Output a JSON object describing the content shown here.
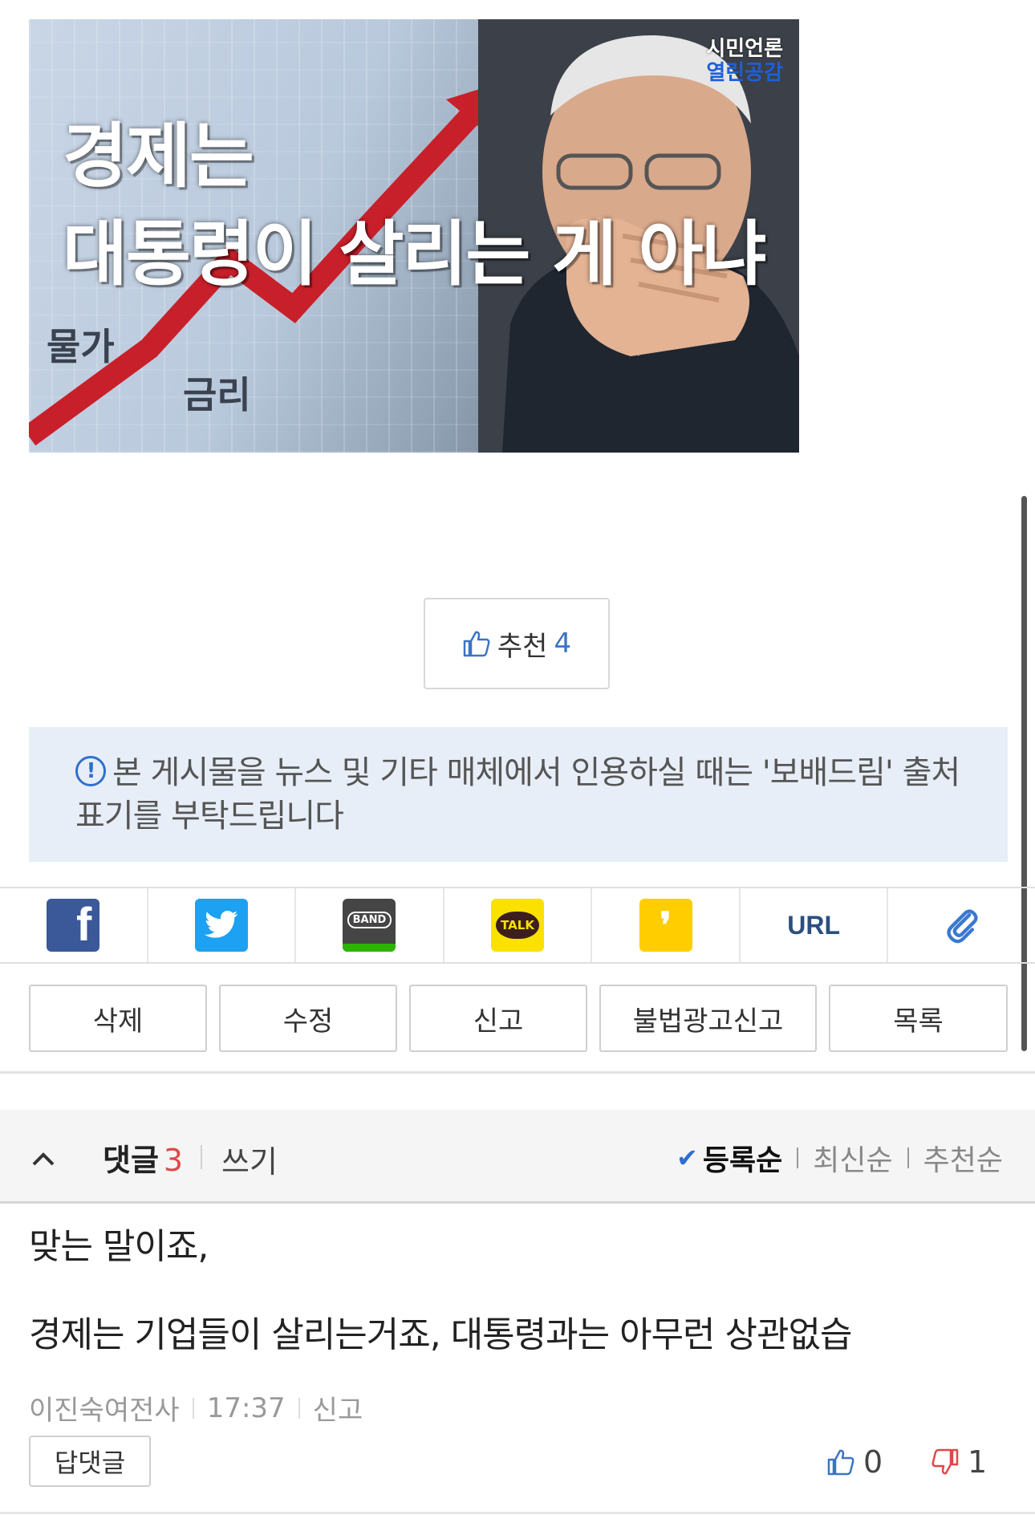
{
  "hero": {
    "headline_line1": "경제는",
    "headline_line2": "대통령이 살리는 게 아냐",
    "label_prices": "물가",
    "label_rates": "금리",
    "brand_line1": "시민언론",
    "brand_line2": "열린공감"
  },
  "recommend": {
    "label": "추천",
    "count": "4",
    "icon": "thumbs-up-icon"
  },
  "notice": {
    "icon": "info-circle-icon",
    "text": "본 게시물을 뉴스 및 기타 매체에서 인용하실 때는 '보배드림' 출처 표기를 부탁드립니다"
  },
  "share": {
    "items": [
      {
        "name": "facebook",
        "glyph": "f",
        "color": "#3b5998"
      },
      {
        "name": "twitter",
        "color": "#1da1f2"
      },
      {
        "name": "band",
        "glyph": "BAND",
        "color": "#454545"
      },
      {
        "name": "kakaotalk",
        "glyph": "TALK",
        "color": "#fae100"
      },
      {
        "name": "kakaostory",
        "glyph": "❜",
        "color": "#ffcd00"
      },
      {
        "name": "url",
        "glyph": "URL"
      },
      {
        "name": "clip",
        "glyph": "📎"
      }
    ]
  },
  "actions": {
    "delete": "삭제",
    "edit": "수정",
    "report": "신고",
    "illegal_ad_report": "불법광고신고",
    "list": "목록"
  },
  "comments": {
    "title": "댓글",
    "count": "3",
    "write": "쓰기",
    "sort_registered": "등록순",
    "sort_latest": "최신순",
    "sort_recommended": "추천순",
    "active_sort": "등록순",
    "items": [
      {
        "line1": "맞는 말이죠,",
        "line2": "경제는 기업들이 살리는거죠, 대통령과는 아무런 상관없습",
        "author": "이진숙여전사",
        "time": "17:37",
        "report": "신고",
        "reply": "답댓글",
        "up": "0",
        "down": "1"
      }
    ]
  },
  "colors": {
    "accent": "#3b74c4",
    "count_red": "#e04848",
    "notice_bg": "#e8eef7"
  }
}
